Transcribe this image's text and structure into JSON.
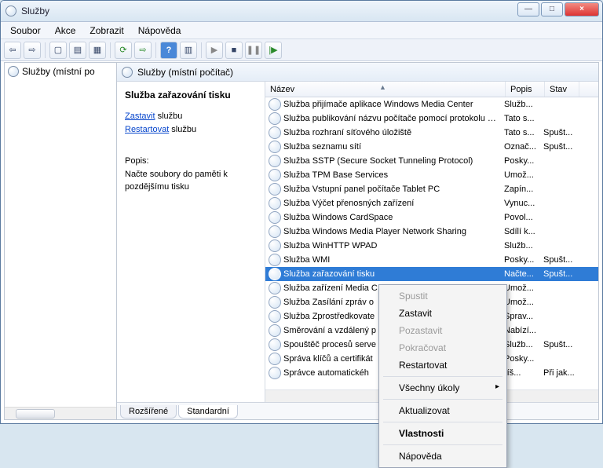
{
  "window": {
    "title": "Služby"
  },
  "winbuttons": {
    "min": "—",
    "max": "□",
    "close": "×"
  },
  "menu": {
    "file": "Soubor",
    "action": "Akce",
    "view": "Zobrazit",
    "help": "Nápověda"
  },
  "toolbar": {
    "back": "⇦",
    "fwd": "⇨",
    "up_s": "▢",
    "up": "▤",
    "export": "▦",
    "refresh": "⟳",
    "refresh2": "⇨",
    "help": "?",
    "props": "▥",
    "play": "▶",
    "stop": "■",
    "pause": "❚❚",
    "restart": "|▶"
  },
  "tree": {
    "root": "Služby (místní po"
  },
  "panel": {
    "title": "Služby (místní počítač)"
  },
  "detail": {
    "heading": "Služba zařazování tisku",
    "stop_link": "Zastavit",
    "stop_suffix": " službu",
    "restart_link": "Restartovat",
    "restart_suffix": " službu",
    "desc_label": "Popis:",
    "desc_text": "Načte soubory do paměti k pozdějšímu tisku"
  },
  "columns": {
    "name": "Název",
    "desc": "Popis",
    "state": "Stav"
  },
  "services": [
    {
      "name": "Služba přijímače aplikace Windows Media Center",
      "desc": "Služb...",
      "state": ""
    },
    {
      "name": "Služba publikování názvu počítače pomocí protokolu PN...",
      "desc": "Tato s...",
      "state": ""
    },
    {
      "name": "Služba rozhraní síťového úložiště",
      "desc": "Tato s...",
      "state": "Spušt..."
    },
    {
      "name": "Služba seznamu sítí",
      "desc": "Označ...",
      "state": "Spušt..."
    },
    {
      "name": "Služba SSTP (Secure Socket Tunneling Protocol)",
      "desc": "Posky...",
      "state": ""
    },
    {
      "name": "Služba TPM Base Services",
      "desc": "Umož...",
      "state": ""
    },
    {
      "name": "Služba Vstupní panel počítače Tablet PC",
      "desc": "Zapín...",
      "state": ""
    },
    {
      "name": "Služba Výčet přenosných zařízení",
      "desc": "Vynuc...",
      "state": ""
    },
    {
      "name": "Služba Windows CardSpace",
      "desc": "Povol...",
      "state": ""
    },
    {
      "name": "Služba Windows Media Player Network Sharing",
      "desc": "Sdílí k...",
      "state": ""
    },
    {
      "name": "Služba WinHTTP WPAD",
      "desc": "Služb...",
      "state": ""
    },
    {
      "name": "Služba WMI",
      "desc": "Posky...",
      "state": "Spušt..."
    },
    {
      "name": "Služba zařazování tisku",
      "desc": "Načte...",
      "state": "Spušt...",
      "selected": true
    },
    {
      "name": "Služba zařízení Media C",
      "desc": "Umož...",
      "state": ""
    },
    {
      "name": "Služba Zasílání zpráv o",
      "desc": "Umož...",
      "state": ""
    },
    {
      "name": "Služba Zprostředkovate",
      "desc": "Sprav...",
      "state": ""
    },
    {
      "name": "Směrování a vzdálený p",
      "desc": "Nabízí...",
      "state": ""
    },
    {
      "name": "Spouštěč procesů serve",
      "desc": "Služb...",
      "state": "Spušt..."
    },
    {
      "name": "Správa klíčů a certifikát",
      "desc": "Posky...",
      "state": ""
    },
    {
      "name": "Správce automatickéh",
      "desc": "říš...",
      "state": "Při jak..."
    }
  ],
  "tabs": {
    "extended": "Rozšířené",
    "standard": "Standardní"
  },
  "context_menu": {
    "start": "Spustit",
    "stop": "Zastavit",
    "pause": "Pozastavit",
    "resume": "Pokračovat",
    "restart": "Restartovat",
    "all_tasks": "Všechny úkoly",
    "refresh": "Aktualizovat",
    "properties": "Vlastnosti",
    "help": "Nápověda"
  }
}
